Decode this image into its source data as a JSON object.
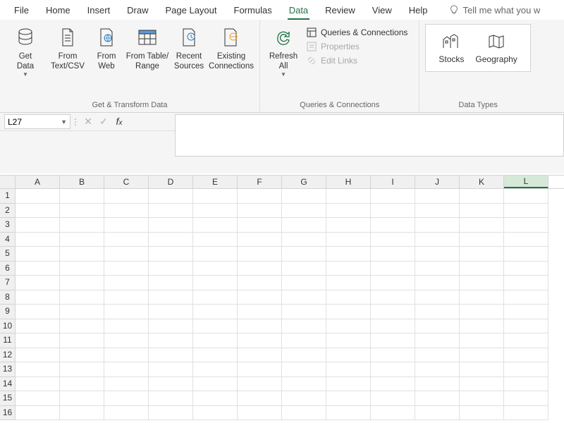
{
  "tabs": [
    "File",
    "Home",
    "Insert",
    "Draw",
    "Page Layout",
    "Formulas",
    "Data",
    "Review",
    "View",
    "Help"
  ],
  "active_tab": "Data",
  "tellme_placeholder": "Tell me what you w",
  "ribbon": {
    "get_transform": {
      "buttons": {
        "get_data": "Get\nData",
        "from_textcsv": "From\nText/CSV",
        "from_web": "From\nWeb",
        "from_table": "From Table/\nRange",
        "recent_sources": "Recent\nSources",
        "existing_conn": "Existing\nConnections"
      },
      "group_label": "Get & Transform Data"
    },
    "queries": {
      "refresh_all": "Refresh\nAll",
      "queries_connections": "Queries & Connections",
      "properties": "Properties",
      "edit_links": "Edit Links",
      "group_label": "Queries & Connections"
    },
    "datatypes": {
      "stocks": "Stocks",
      "geography": "Geography",
      "group_label": "Data Types"
    }
  },
  "namebox_value": "L27",
  "columns": [
    "A",
    "B",
    "C",
    "D",
    "E",
    "F",
    "G",
    "H",
    "I",
    "J",
    "K",
    "L"
  ],
  "selected_column": "L",
  "row_count": 16
}
